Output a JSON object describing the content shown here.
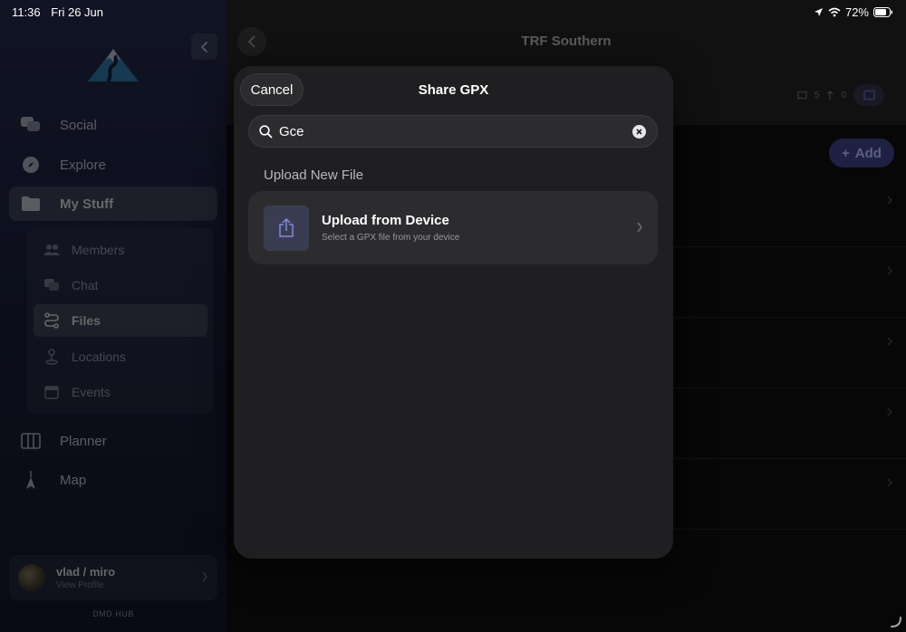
{
  "status_bar": {
    "time": "11:36",
    "date": "Fri 26 Jun",
    "battery": "72%"
  },
  "sidebar": {
    "nav": [
      {
        "label": "Social",
        "icon": "chat-bubbles-icon"
      },
      {
        "label": "Explore",
        "icon": "compass-icon"
      },
      {
        "label": "My Stuff",
        "icon": "folder-icon"
      },
      {
        "label": "Planner",
        "icon": "columns-icon"
      },
      {
        "label": "Map",
        "icon": "map-pin-icon"
      }
    ],
    "sub_nav": [
      {
        "label": "Members",
        "icon": "people-icon"
      },
      {
        "label": "Chat",
        "icon": "chat-icon"
      },
      {
        "label": "Files",
        "icon": "route-icon"
      },
      {
        "label": "Locations",
        "icon": "location-pin-icon"
      },
      {
        "label": "Events",
        "icon": "calendar-icon"
      }
    ],
    "profile": {
      "name": "vlad / miro",
      "subtitle": "View Profile"
    },
    "footer": "DMD HUB"
  },
  "main": {
    "title": "TRF Southern",
    "stats": {
      "maps": "5",
      "uploads": "0"
    },
    "add_label": "Add"
  },
  "modal": {
    "cancel_label": "Cancel",
    "title": "Share GPX",
    "search_value": "Gce",
    "section_title": "Upload New File",
    "upload": {
      "title": "Upload from Device",
      "subtitle": "Select a GPX file from your device"
    }
  },
  "colors": {
    "accent": "#5b63c4",
    "modal_bg": "#1f1f21",
    "card_bg": "#2c2c2e"
  }
}
